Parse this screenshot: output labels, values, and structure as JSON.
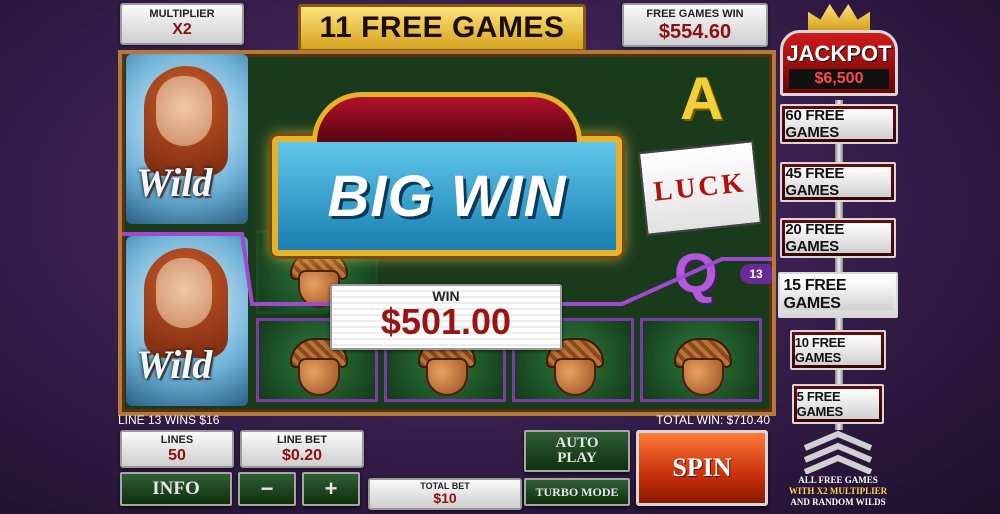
{
  "header": {
    "multiplier_label": "MULTIPLIER",
    "multiplier_value": "X2",
    "free_games_title": "11 FREE GAMES",
    "free_games_win_label": "FREE GAMES WIN",
    "free_games_win_value": "$554.60"
  },
  "big_win": {
    "title": "BIG WIN",
    "win_label": "WIN",
    "win_amount": "$501.00"
  },
  "reels": {
    "wild_text": "Wild",
    "luck_text": "LUCK",
    "ace": "A",
    "queen": "Q",
    "payline_number": "13"
  },
  "jackpot": {
    "title": "JACKPOT",
    "amount": "$6,500",
    "levels": [
      "60 FREE GAMES",
      "45 FREE GAMES",
      "20 FREE GAMES",
      "15 FREE GAMES",
      "10 FREE GAMES",
      "5 FREE GAMES"
    ],
    "footer_line1": "ALL FREE GAMES",
    "footer_line2": "WITH X2 MULTIPLIER",
    "footer_line3": "AND RANDOM WILDS"
  },
  "status": {
    "line_wins": "LINE 13 WINS $16",
    "total_win": "TOTAL WIN: $710.40"
  },
  "controls": {
    "lines_label": "LINES",
    "lines_value": "50",
    "line_bet_label": "LINE BET",
    "line_bet_value": "$0.20",
    "info": "INFO",
    "minus": "−",
    "plus": "+",
    "total_bet_label": "TOTAL BET",
    "total_bet_value": "$10",
    "auto_play": "AUTO PLAY",
    "turbo_mode": "TURBO MODE",
    "spin": "SPIN"
  }
}
